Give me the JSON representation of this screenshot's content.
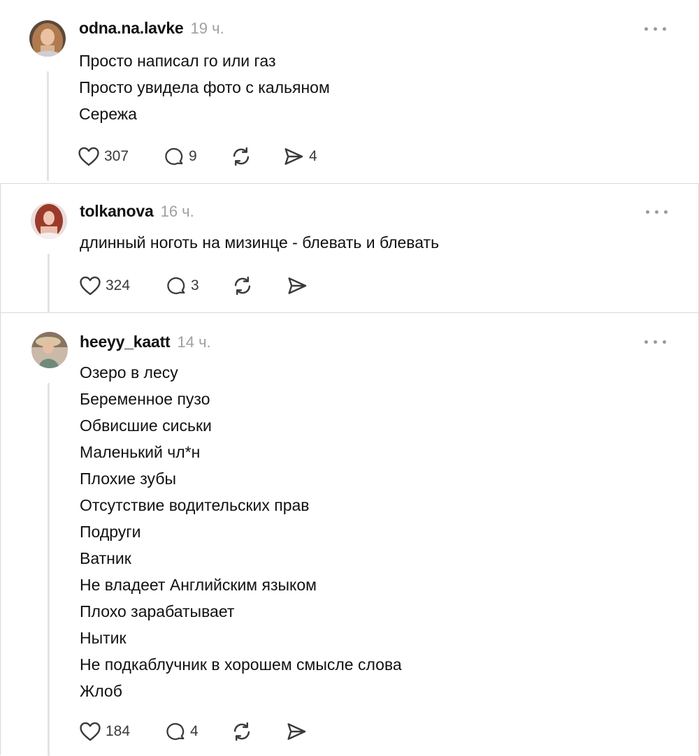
{
  "posts": [
    {
      "username": "odna.na.lavke",
      "time": "19 ч.",
      "lines": [
        "Просто написал го или газ",
        "Просто увидела фото с кальяном",
        "Сережа"
      ],
      "likes": "307",
      "comments": "9",
      "reposts": "",
      "shares": "4"
    },
    {
      "username": "tolkanova",
      "time": "16 ч.",
      "lines": [
        "длинный ноготь на мизинце - блевать и блевать"
      ],
      "likes": "324",
      "comments": "3",
      "reposts": "",
      "shares": ""
    },
    {
      "username": "heeyy_kaatt",
      "time": "14 ч.",
      "lines": [
        "Озеро в лесу",
        "Беременное пузо",
        "Обвисшие сиськи",
        "Маленький чл*н",
        "Плохие зубы",
        "Отсутствие водительских прав",
        "Подруги",
        "Ватник",
        "Не владеет Английским языком",
        "Плохо зарабатывает",
        "Нытик",
        "Не подкаблучник в хорошем смысле слова",
        "Жлоб"
      ],
      "likes": "184",
      "comments": "4",
      "reposts": "",
      "shares": ""
    }
  ],
  "icons": {
    "like": "heart-icon",
    "comment": "comment-bubble-icon",
    "repost": "repost-icon",
    "share": "send-icon",
    "more": "more-options-icon"
  },
  "colors": {
    "text": "#111111",
    "muted": "#a0a0a0",
    "icon": "#3a3a3a",
    "divider": "#d9d9d9",
    "thread_line": "#e3e3e3"
  }
}
